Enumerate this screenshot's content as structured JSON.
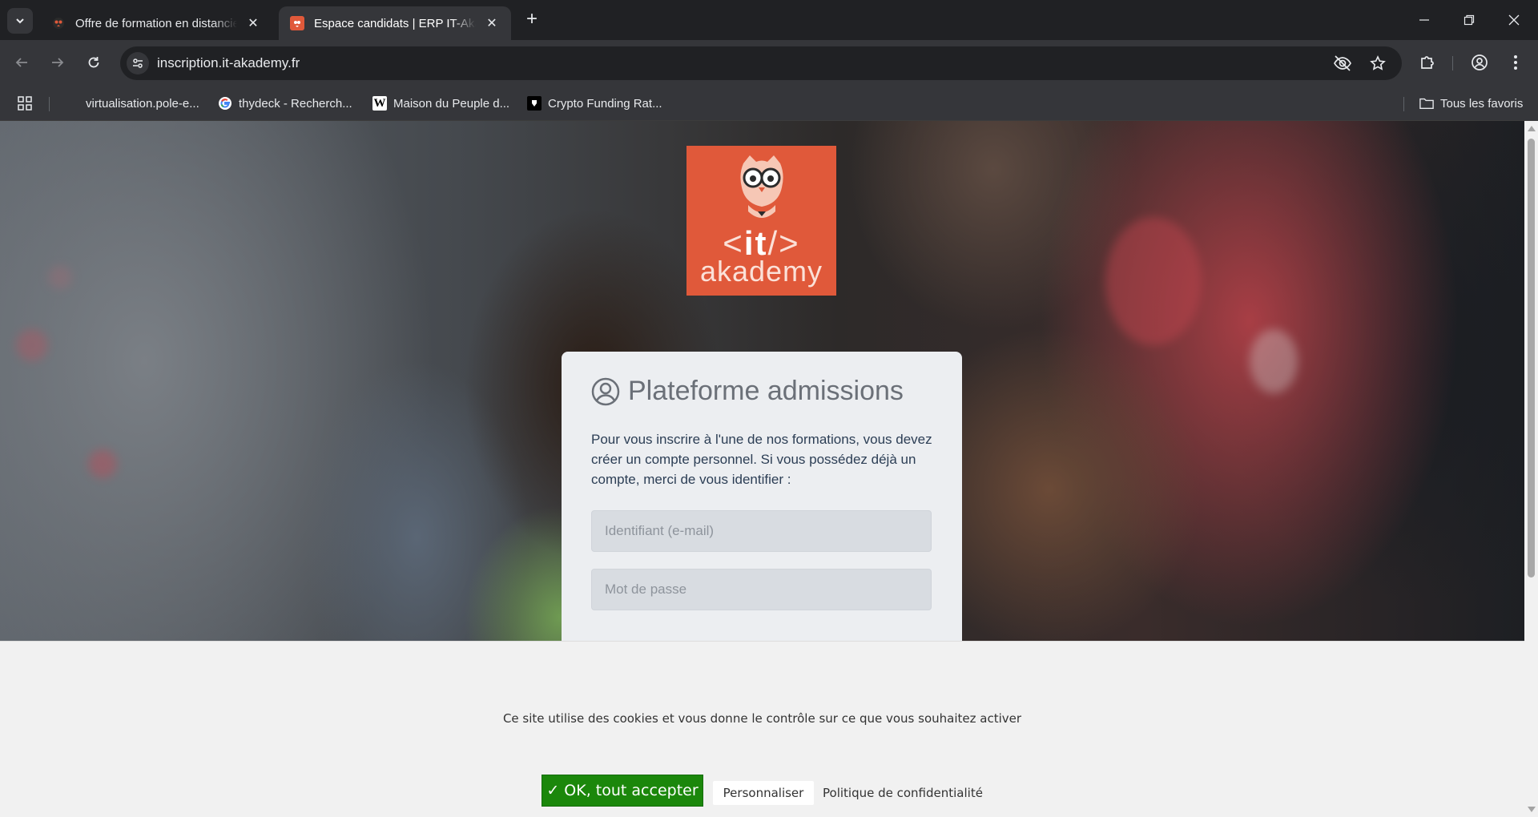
{
  "browser": {
    "tabs": [
      {
        "title": "Offre de formation en distanciel",
        "active": false,
        "favicon": "it-akademy-favicon"
      },
      {
        "title": "Espace candidats | ERP IT-Akademy",
        "active": true,
        "favicon": "it-akademy-favicon"
      }
    ],
    "url": "inscription.it-akademy.fr",
    "bookmarks": [
      {
        "label": "virtualisation.pole-e...",
        "icon": "none"
      },
      {
        "label": "thydeck - Recherch...",
        "icon": "google-icon"
      },
      {
        "label": "Maison du Peuple d...",
        "icon": "wikipedia-icon"
      },
      {
        "label": "Crypto Funding Rat...",
        "icon": "crypto-site-icon"
      }
    ],
    "all_bookmarks_label": "Tous les favoris"
  },
  "page": {
    "logo": {
      "line1": "it",
      "line2": "akademy",
      "color": "#e0593a"
    },
    "card": {
      "title": "Plateforme admissions",
      "intro": "Pour vous inscrire à l'une de nos formations, vous devez créer un compte personnel. Si vous possédez déjà un compte, merci de vous identifier :",
      "email_placeholder": "Identifiant (e-mail)",
      "password_placeholder": "Mot de passe"
    }
  },
  "cookie_banner": {
    "message": "Ce site utilise des cookies et vous donne le contrôle sur ce que vous souhaitez activer",
    "accept_label": "✓ OK, tout accepter",
    "customize_label": "Personnaliser",
    "policy_label": "Politique de confidentialité",
    "accept_color": "#1b870b"
  }
}
